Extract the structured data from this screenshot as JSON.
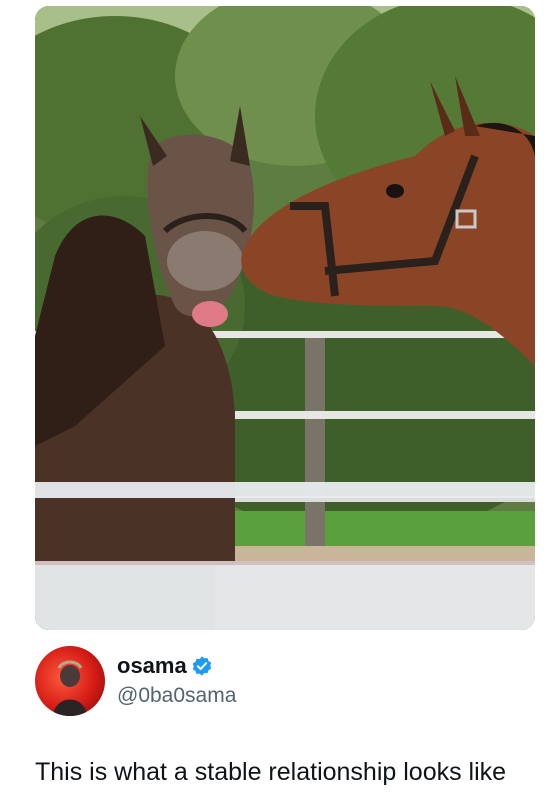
{
  "post": {
    "image": {
      "alt_icon": "horses-photo"
    },
    "author": {
      "display_name": "osama",
      "handle": "@0ba0sama",
      "verified": true,
      "verified_color": "#1d9bf0"
    },
    "text": "This is what a stable relationship looks like"
  }
}
